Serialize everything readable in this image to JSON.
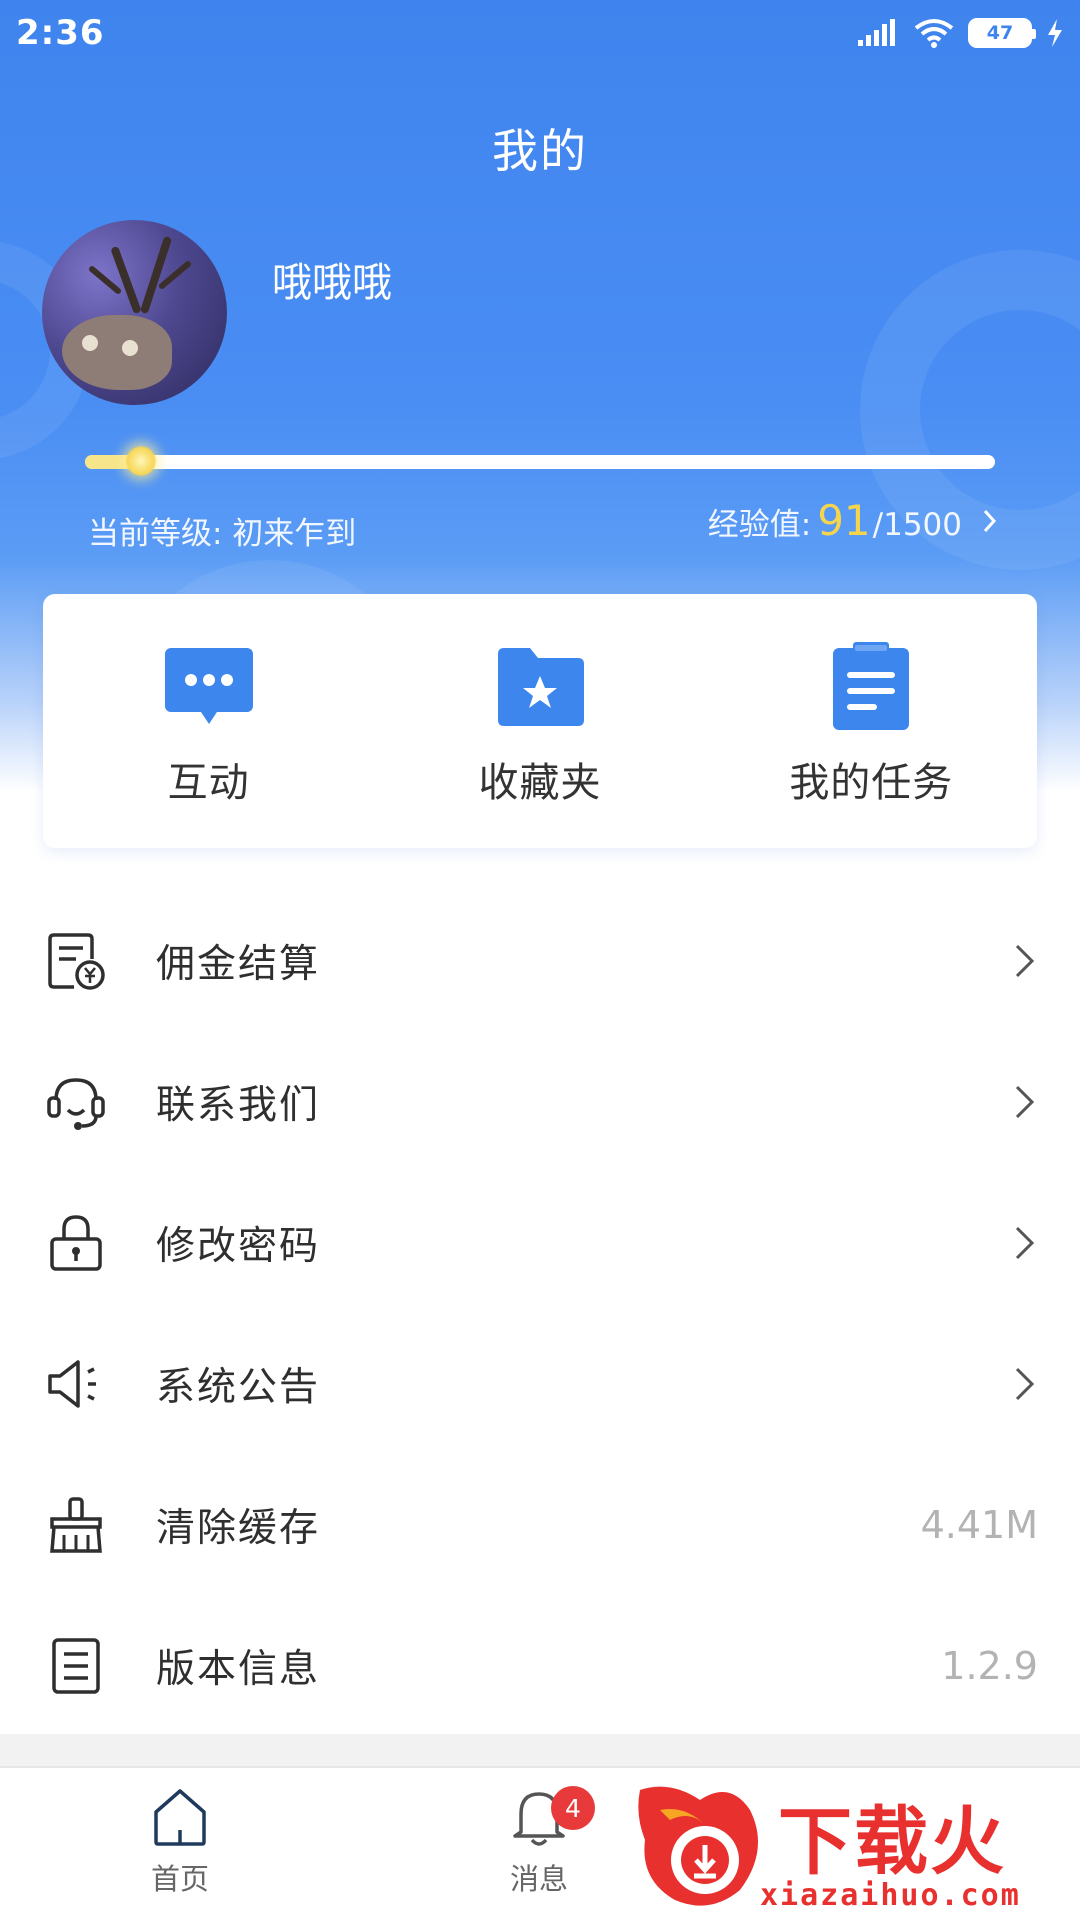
{
  "status_bar": {
    "time": "2:36",
    "battery": "47"
  },
  "header": {
    "title": "我的"
  },
  "profile": {
    "username": "哦哦哦",
    "level_label": "当前等级: 初来乍到",
    "exp_label": "经验值:",
    "exp_current": "91",
    "exp_total": "/1500",
    "exp_progress_fraction": 0.061
  },
  "quick_actions": [
    {
      "label": "互动",
      "icon": "chat-bubble-icon"
    },
    {
      "label": "收藏夹",
      "icon": "star-folder-icon"
    },
    {
      "label": "我的任务",
      "icon": "clipboard-icon"
    }
  ],
  "menu": [
    {
      "label": "佣金结算",
      "icon": "invoice-yuan-icon",
      "value": ""
    },
    {
      "label": "联系我们",
      "icon": "headset-icon",
      "value": ""
    },
    {
      "label": "修改密码",
      "icon": "lock-icon",
      "value": ""
    },
    {
      "label": "系统公告",
      "icon": "speaker-icon",
      "value": ""
    },
    {
      "label": "清除缓存",
      "icon": "broom-icon",
      "value": "4.41M"
    },
    {
      "label": "版本信息",
      "icon": "document-icon",
      "value": "1.2.9"
    }
  ],
  "bottom_nav": {
    "home_label": "首页",
    "messages_label": "消息",
    "messages_badge": "4"
  },
  "watermark": {
    "text": "下载火",
    "url": "xiazaihuo.com"
  },
  "colors": {
    "header_blue": "#3f84ee",
    "accent_blue": "#3d86ee",
    "exp_yellow": "#f5d44e",
    "badge_red": "#e83a3a",
    "watermark_red": "#e8302f"
  }
}
